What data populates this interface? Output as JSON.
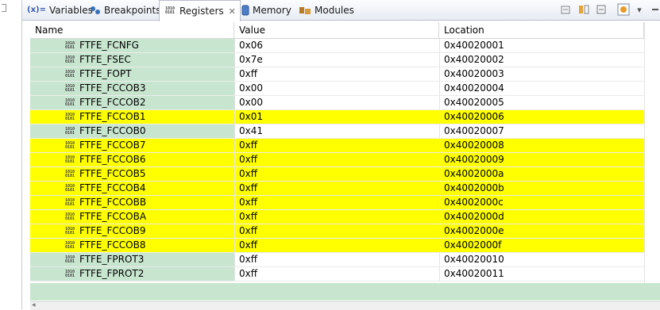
{
  "tabs": [
    {
      "label": "Variables",
      "icon": "variables-icon",
      "glyph": "(x)="
    },
    {
      "label": "Breakpoints",
      "icon": "breakpoints-icon"
    },
    {
      "label": "Registers",
      "icon": "registers-icon",
      "active": true
    },
    {
      "label": "Memory",
      "icon": "memory-icon"
    },
    {
      "label": "Modules",
      "icon": "modules-icon"
    }
  ],
  "columns": {
    "name": "Name",
    "value": "Value",
    "location": "Location"
  },
  "rows": [
    {
      "name": "FTFE_FCNFG",
      "value": "0x06",
      "location": "0x40020001",
      "highlight": "none"
    },
    {
      "name": "FTFE_FSEC",
      "value": "0x7e",
      "location": "0x40020002",
      "highlight": "none"
    },
    {
      "name": "FTFE_FOPT",
      "value": "0xff",
      "location": "0x40020003",
      "highlight": "none"
    },
    {
      "name": "FTFE_FCCOB3",
      "value": "0x00",
      "location": "0x40020004",
      "highlight": "none"
    },
    {
      "name": "FTFE_FCCOB2",
      "value": "0x00",
      "location": "0x40020005",
      "highlight": "none"
    },
    {
      "name": "FTFE_FCCOB1",
      "value": "0x01",
      "location": "0x40020006",
      "highlight": "yellow"
    },
    {
      "name": "FTFE_FCCOB0",
      "value": "0x41",
      "location": "0x40020007",
      "highlight": "none"
    },
    {
      "name": "FTFE_FCCOB7",
      "value": "0xff",
      "location": "0x40020008",
      "highlight": "yellow"
    },
    {
      "name": "FTFE_FCCOB6",
      "value": "0xff",
      "location": "0x40020009",
      "highlight": "yellow"
    },
    {
      "name": "FTFE_FCCOB5",
      "value": "0xff",
      "location": "0x4002000a",
      "highlight": "yellow"
    },
    {
      "name": "FTFE_FCCOB4",
      "value": "0xff",
      "location": "0x4002000b",
      "highlight": "yellow"
    },
    {
      "name": "FTFE_FCCOBB",
      "value": "0xff",
      "location": "0x4002000c",
      "highlight": "yellow"
    },
    {
      "name": "FTFE_FCCOBA",
      "value": "0xff",
      "location": "0x4002000d",
      "highlight": "yellow"
    },
    {
      "name": "FTFE_FCCOB9",
      "value": "0xff",
      "location": "0x4002000e",
      "highlight": "yellow"
    },
    {
      "name": "FTFE_FCCOB8",
      "value": "0xff",
      "location": "0x4002000f",
      "highlight": "yellow"
    },
    {
      "name": "FTFE_FPROT3",
      "value": "0xff",
      "location": "0x40020010",
      "highlight": "none"
    },
    {
      "name": "FTFE_FPROT2",
      "value": "0xff",
      "location": "0x40020011",
      "highlight": "none"
    }
  ],
  "colors": {
    "highlight": "#ffff00",
    "name_bg": "#c8e6cf"
  }
}
